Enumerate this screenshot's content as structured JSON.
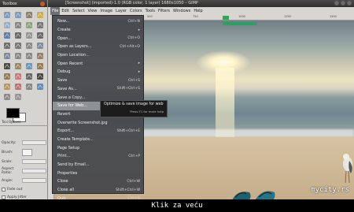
{
  "toolbox": {
    "title": "Toolbox",
    "tab_label": "Tool Options",
    "options": {
      "opacity_label": "Opacity:",
      "brush_label": "Brush:",
      "scale_label": "Scale:",
      "aspect_label": "Aspect Ratio:",
      "angle_label": "Angle:",
      "fade_label": "Fade out",
      "jitter_label": "Apply Jitter"
    },
    "tools": [
      "rect-select-icon",
      "ellipse-select-icon",
      "lasso-icon",
      "fuzzy-select-icon",
      "color-select-icon",
      "scissors-icon",
      "foreground-select-icon",
      "paths-icon",
      "color-picker-icon",
      "zoom-icon",
      "measure-icon",
      "move-icon",
      "align-icon",
      "crop-icon",
      "rotate-icon",
      "scale-icon",
      "shear-icon",
      "perspective-icon",
      "flip-icon",
      "cage-icon",
      "text-icon",
      "bucket-fill-icon",
      "blend-icon",
      "pencil-icon",
      "paintbrush-icon",
      "eraser-icon",
      "airbrush-icon",
      "ink-icon",
      "clone-icon",
      "heal-icon",
      "perspective-clone-icon",
      "blur-icon",
      "smudge-icon",
      "dodge-burn-icon"
    ],
    "tool_colors": [
      "#6f8fb6",
      "#6f8fb6",
      "#7c7060",
      "#c4a43a",
      "#8fa5c0",
      "#777",
      "#7e9a6b",
      "#666",
      "#4a6f9c",
      "#555",
      "#888",
      "#555",
      "#5b5b5b",
      "#666",
      "#7a7a7a",
      "#6e7d8f",
      "#6e7d8f",
      "#7a7a7a",
      "#7a7a7a",
      "#8a6f55",
      "#333",
      "#8c7a50",
      "#5c89b0",
      "#8a6a40",
      "#8a6a40",
      "#c46a6a",
      "#555",
      "#2b2b2b",
      "#b38a55",
      "#b36060",
      "#777",
      "#4f7cae",
      "#7d7d7d",
      "#888"
    ],
    "fg_color": "#000000",
    "bg_color": "#ffffff"
  },
  "window": {
    "title": "[Screenshot] (imported)-1.0 (RGB color, 1 layer) 1680x1050 – GIMP"
  },
  "menubar": [
    "File",
    "Edit",
    "Select",
    "View",
    "Image",
    "Layer",
    "Colors",
    "Tools",
    "Filters",
    "Windows",
    "Help"
  ],
  "ruler": [
    "250",
    "500",
    "750",
    "1000",
    "1250",
    "1500"
  ],
  "file_menu": {
    "items": [
      {
        "label": "New...",
        "shortcut": "Ctrl+N"
      },
      {
        "label": "Create",
        "shortcut": "▸"
      },
      {
        "label": "Open...",
        "shortcut": "Ctrl+O"
      },
      {
        "label": "Open as Layers...",
        "shortcut": "Ctrl+Alt+O"
      },
      {
        "label": "Open Location...",
        "shortcut": ""
      },
      {
        "label": "Open Recent",
        "shortcut": "▸"
      },
      {
        "label": "Debug",
        "shortcut": "▸"
      },
      {
        "label": "Save",
        "shortcut": "Ctrl+S"
      },
      {
        "label": "Save As...",
        "shortcut": "Shift+Ctrl+S"
      },
      {
        "label": "Save a Copy...",
        "shortcut": ""
      },
      {
        "label": "Save for Web...",
        "shortcut": ""
      },
      {
        "label": "Revert",
        "shortcut": ""
      },
      {
        "label": "Overwrite Screenshot.jpg",
        "shortcut": ""
      },
      {
        "label": "Export...",
        "shortcut": "Shift+Ctrl+E"
      },
      {
        "label": "Create Template...",
        "shortcut": ""
      },
      {
        "label": "Page Setup",
        "shortcut": ""
      },
      {
        "label": "Print...",
        "shortcut": "Ctrl+P"
      },
      {
        "label": "Send by Email...",
        "shortcut": ""
      },
      {
        "label": "Properties",
        "shortcut": ""
      },
      {
        "label": "Close",
        "shortcut": "Ctrl+W"
      },
      {
        "label": "Close all",
        "shortcut": "Shift+Ctrl+W"
      },
      {
        "label": "Quit",
        "shortcut": "Ctrl+Q"
      }
    ],
    "highlighted_index": 10
  },
  "tooltip": {
    "text": "Optimize & save image for web",
    "hint": "Press F1 for more help"
  },
  "watermark": "mycity.rs",
  "caption": "Klik za veću"
}
